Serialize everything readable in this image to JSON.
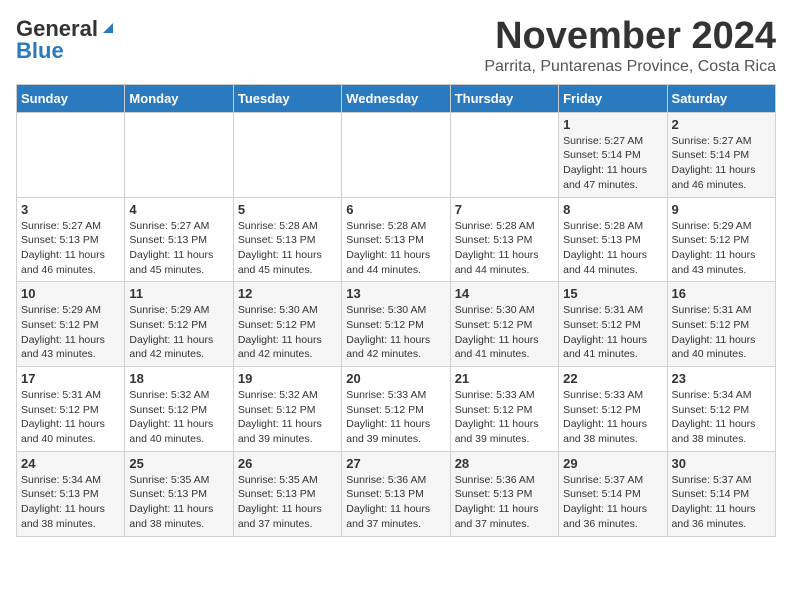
{
  "logo": {
    "line1": "General",
    "line2": "Blue"
  },
  "title": "November 2024",
  "location": "Parrita, Puntarenas Province, Costa Rica",
  "weekdays": [
    "Sunday",
    "Monday",
    "Tuesday",
    "Wednesday",
    "Thursday",
    "Friday",
    "Saturday"
  ],
  "weeks": [
    [
      {
        "day": "",
        "info": ""
      },
      {
        "day": "",
        "info": ""
      },
      {
        "day": "",
        "info": ""
      },
      {
        "day": "",
        "info": ""
      },
      {
        "day": "",
        "info": ""
      },
      {
        "day": "1",
        "info": "Sunrise: 5:27 AM\nSunset: 5:14 PM\nDaylight: 11 hours\nand 47 minutes."
      },
      {
        "day": "2",
        "info": "Sunrise: 5:27 AM\nSunset: 5:14 PM\nDaylight: 11 hours\nand 46 minutes."
      }
    ],
    [
      {
        "day": "3",
        "info": "Sunrise: 5:27 AM\nSunset: 5:13 PM\nDaylight: 11 hours\nand 46 minutes."
      },
      {
        "day": "4",
        "info": "Sunrise: 5:27 AM\nSunset: 5:13 PM\nDaylight: 11 hours\nand 45 minutes."
      },
      {
        "day": "5",
        "info": "Sunrise: 5:28 AM\nSunset: 5:13 PM\nDaylight: 11 hours\nand 45 minutes."
      },
      {
        "day": "6",
        "info": "Sunrise: 5:28 AM\nSunset: 5:13 PM\nDaylight: 11 hours\nand 44 minutes."
      },
      {
        "day": "7",
        "info": "Sunrise: 5:28 AM\nSunset: 5:13 PM\nDaylight: 11 hours\nand 44 minutes."
      },
      {
        "day": "8",
        "info": "Sunrise: 5:28 AM\nSunset: 5:13 PM\nDaylight: 11 hours\nand 44 minutes."
      },
      {
        "day": "9",
        "info": "Sunrise: 5:29 AM\nSunset: 5:12 PM\nDaylight: 11 hours\nand 43 minutes."
      }
    ],
    [
      {
        "day": "10",
        "info": "Sunrise: 5:29 AM\nSunset: 5:12 PM\nDaylight: 11 hours\nand 43 minutes."
      },
      {
        "day": "11",
        "info": "Sunrise: 5:29 AM\nSunset: 5:12 PM\nDaylight: 11 hours\nand 42 minutes."
      },
      {
        "day": "12",
        "info": "Sunrise: 5:30 AM\nSunset: 5:12 PM\nDaylight: 11 hours\nand 42 minutes."
      },
      {
        "day": "13",
        "info": "Sunrise: 5:30 AM\nSunset: 5:12 PM\nDaylight: 11 hours\nand 42 minutes."
      },
      {
        "day": "14",
        "info": "Sunrise: 5:30 AM\nSunset: 5:12 PM\nDaylight: 11 hours\nand 41 minutes."
      },
      {
        "day": "15",
        "info": "Sunrise: 5:31 AM\nSunset: 5:12 PM\nDaylight: 11 hours\nand 41 minutes."
      },
      {
        "day": "16",
        "info": "Sunrise: 5:31 AM\nSunset: 5:12 PM\nDaylight: 11 hours\nand 40 minutes."
      }
    ],
    [
      {
        "day": "17",
        "info": "Sunrise: 5:31 AM\nSunset: 5:12 PM\nDaylight: 11 hours\nand 40 minutes."
      },
      {
        "day": "18",
        "info": "Sunrise: 5:32 AM\nSunset: 5:12 PM\nDaylight: 11 hours\nand 40 minutes."
      },
      {
        "day": "19",
        "info": "Sunrise: 5:32 AM\nSunset: 5:12 PM\nDaylight: 11 hours\nand 39 minutes."
      },
      {
        "day": "20",
        "info": "Sunrise: 5:33 AM\nSunset: 5:12 PM\nDaylight: 11 hours\nand 39 minutes."
      },
      {
        "day": "21",
        "info": "Sunrise: 5:33 AM\nSunset: 5:12 PM\nDaylight: 11 hours\nand 39 minutes."
      },
      {
        "day": "22",
        "info": "Sunrise: 5:33 AM\nSunset: 5:12 PM\nDaylight: 11 hours\nand 38 minutes."
      },
      {
        "day": "23",
        "info": "Sunrise: 5:34 AM\nSunset: 5:12 PM\nDaylight: 11 hours\nand 38 minutes."
      }
    ],
    [
      {
        "day": "24",
        "info": "Sunrise: 5:34 AM\nSunset: 5:13 PM\nDaylight: 11 hours\nand 38 minutes."
      },
      {
        "day": "25",
        "info": "Sunrise: 5:35 AM\nSunset: 5:13 PM\nDaylight: 11 hours\nand 38 minutes."
      },
      {
        "day": "26",
        "info": "Sunrise: 5:35 AM\nSunset: 5:13 PM\nDaylight: 11 hours\nand 37 minutes."
      },
      {
        "day": "27",
        "info": "Sunrise: 5:36 AM\nSunset: 5:13 PM\nDaylight: 11 hours\nand 37 minutes."
      },
      {
        "day": "28",
        "info": "Sunrise: 5:36 AM\nSunset: 5:13 PM\nDaylight: 11 hours\nand 37 minutes."
      },
      {
        "day": "29",
        "info": "Sunrise: 5:37 AM\nSunset: 5:14 PM\nDaylight: 11 hours\nand 36 minutes."
      },
      {
        "day": "30",
        "info": "Sunrise: 5:37 AM\nSunset: 5:14 PM\nDaylight: 11 hours\nand 36 minutes."
      }
    ]
  ]
}
